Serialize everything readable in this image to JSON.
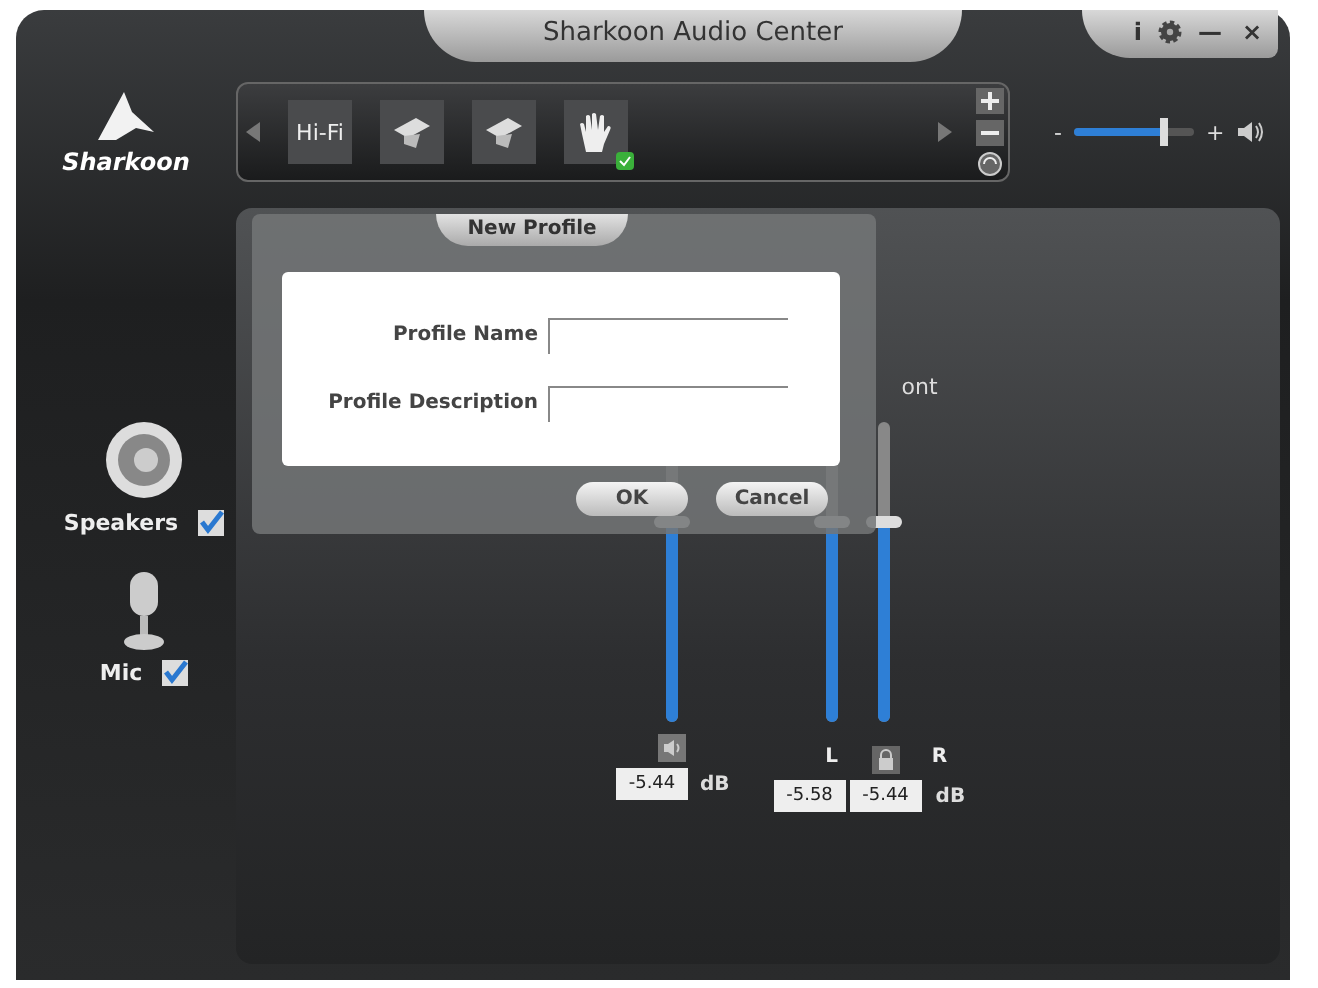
{
  "window": {
    "title": "Sharkoon Audio Center"
  },
  "title_controls": [
    {
      "kind": "text",
      "label": "i"
    },
    {
      "kind": "gear"
    },
    {
      "kind": "text",
      "label": "—"
    },
    {
      "kind": "text",
      "label": "×"
    }
  ],
  "brand": {
    "name": "Sharkoon"
  },
  "presets": [
    {
      "kind": "text",
      "label": "Hi-Fi",
      "selected": false
    },
    {
      "kind": "cap",
      "selected": false
    },
    {
      "kind": "cap",
      "selected": false
    },
    {
      "kind": "hand",
      "selected": true
    }
  ],
  "volume": {
    "minus": "-",
    "plus": "+",
    "level": 0.75
  },
  "devices": [
    {
      "kind": "speaker",
      "name": "Speakers",
      "checked": true
    },
    {
      "kind": "mic",
      "name": "Mic",
      "checked": true
    }
  ],
  "mixer": {
    "channel_label": "ont",
    "master": {
      "level": 0.67,
      "value": "-5.44",
      "unit": "dB"
    },
    "left": {
      "label": "L",
      "level": 0.67,
      "value": "-5.58"
    },
    "right": {
      "label": "R",
      "level": 0.67,
      "value": "-5.44",
      "unit": "dB"
    }
  },
  "dialog": {
    "title": "New Profile",
    "fields": [
      {
        "label": "Profile Name"
      },
      {
        "label": "Profile Description"
      }
    ],
    "buttons": [
      "OK",
      "Cancel"
    ]
  }
}
